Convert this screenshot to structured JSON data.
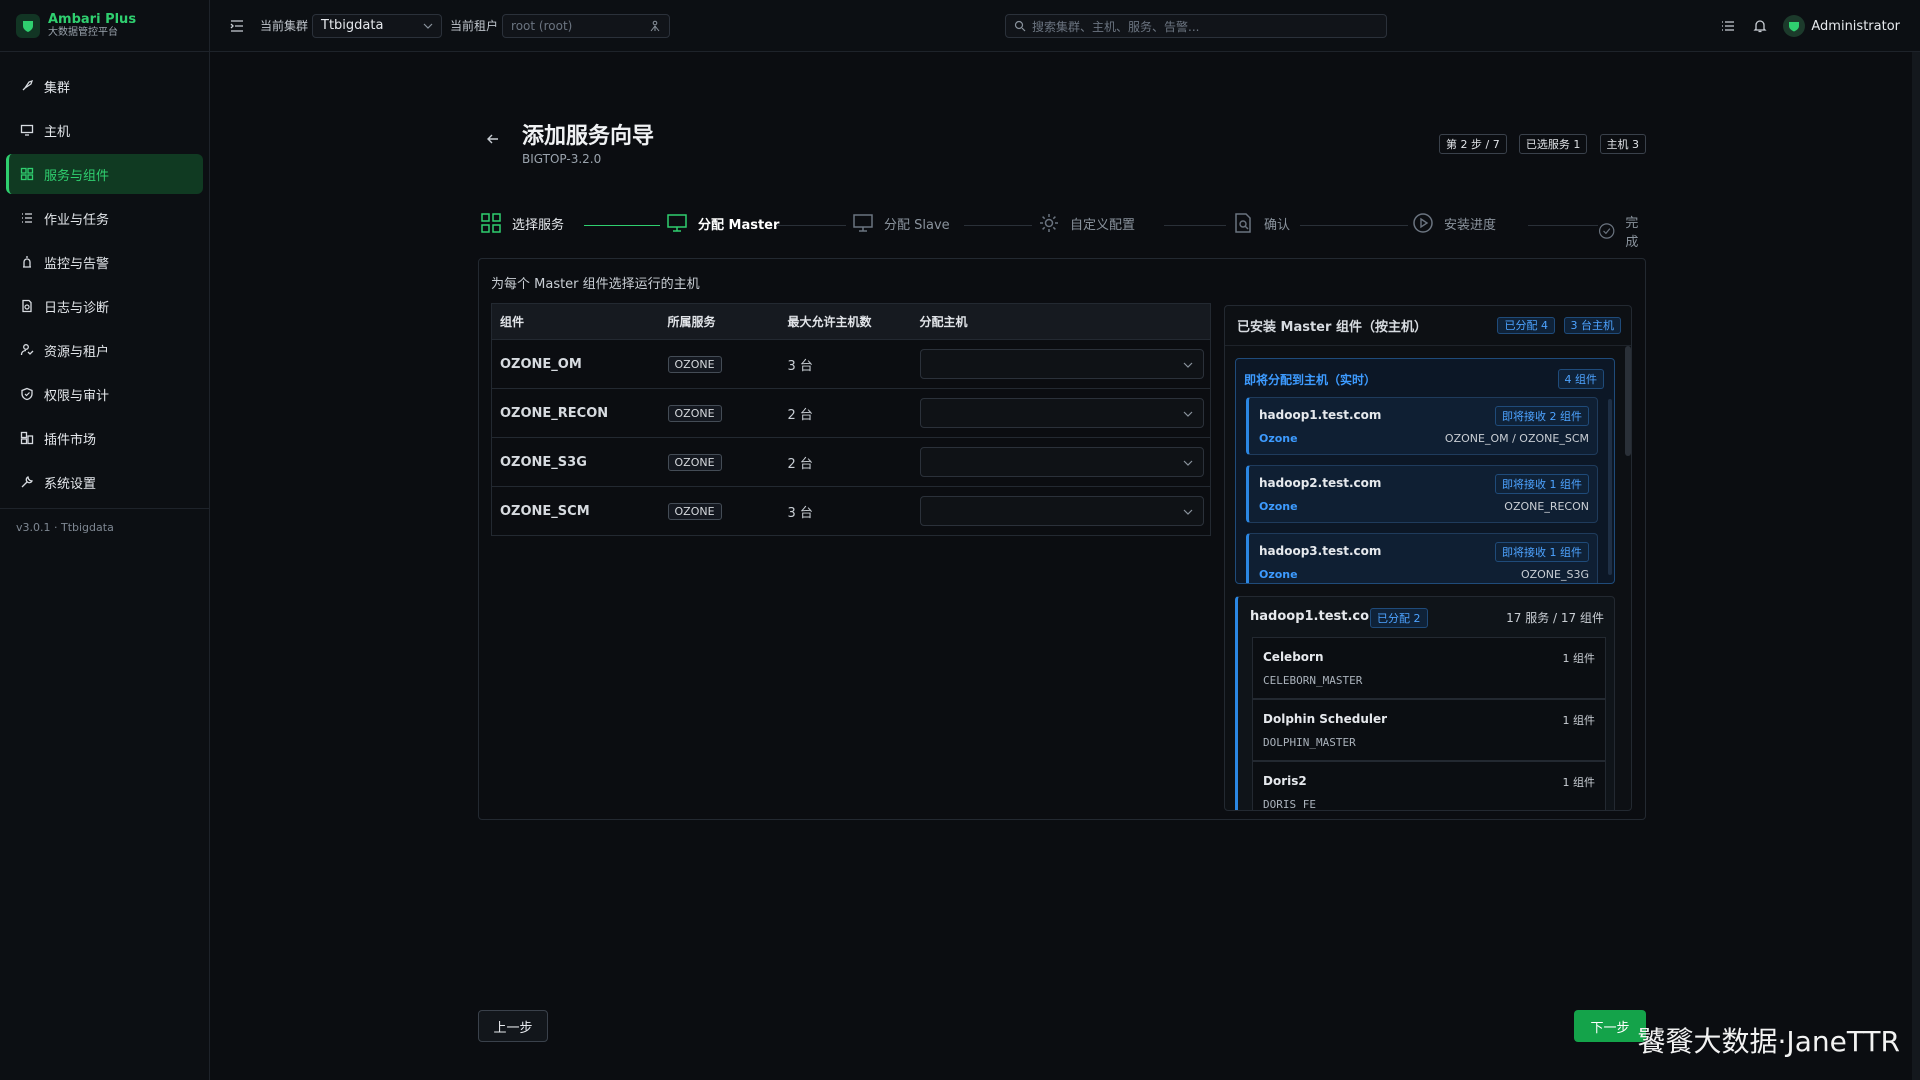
{
  "brand": {
    "title": "Ambari Plus",
    "subtitle": "大数据管控平台"
  },
  "sidebar": {
    "items": [
      {
        "label": "集群",
        "icon": "rocket-icon",
        "active": false
      },
      {
        "label": "主机",
        "icon": "monitor-icon",
        "active": false
      },
      {
        "label": "服务与组件",
        "icon": "grid-icon",
        "active": true
      },
      {
        "label": "作业与任务",
        "icon": "list-icon",
        "active": false
      },
      {
        "label": "监控与告警",
        "icon": "alarm-icon",
        "active": false
      },
      {
        "label": "日志与诊断",
        "icon": "log-icon",
        "active": false
      },
      {
        "label": "资源与租户",
        "icon": "users-icon",
        "active": false
      },
      {
        "label": "权限与审计",
        "icon": "shield-icon",
        "active": false
      },
      {
        "label": "插件市场",
        "icon": "plugin-icon",
        "active": false
      },
      {
        "label": "系统设置",
        "icon": "wrench-icon",
        "active": false
      }
    ],
    "version": "v3.0.1 · Ttbigdata"
  },
  "topbar": {
    "cluster_label": "当前集群",
    "cluster_value": "Ttbigdata",
    "tenant_label": "当前租户",
    "tenant_placeholder": "root (root)",
    "search_placeholder": "搜索集群、主机、服务、告警...",
    "user": "Administrator"
  },
  "wizard": {
    "title": "添加服务向导",
    "version": "BIGTOP-3.2.0",
    "badges": [
      "第 2 步 / 7",
      "已选服务 1",
      "主机 3"
    ],
    "steps": [
      {
        "label": "选择服务",
        "state": "done"
      },
      {
        "label": "分配 Master",
        "state": "active"
      },
      {
        "label": "分配 Slave",
        "state": "pending"
      },
      {
        "label": "自定义配置",
        "state": "pending"
      },
      {
        "label": "确认",
        "state": "pending"
      },
      {
        "label": "安装进度",
        "state": "pending"
      },
      {
        "label": "完成",
        "state": "pending"
      }
    ],
    "instruction": "为每个 Master 组件选择运行的主机",
    "table": {
      "headers": [
        "组件",
        "所属服务",
        "最大允许主机数",
        "分配主机"
      ],
      "rows": [
        {
          "component": "OZONE_OM",
          "service": "OZONE",
          "max": "3 台"
        },
        {
          "component": "OZONE_RECON",
          "service": "OZONE",
          "max": "2 台"
        },
        {
          "component": "OZONE_S3G",
          "service": "OZONE",
          "max": "2 台"
        },
        {
          "component": "OZONE_SCM",
          "service": "OZONE",
          "max": "3 台"
        }
      ]
    },
    "panel": {
      "title": "已安装 Master 组件（按主机）",
      "badge_assigned": "已分配 4",
      "badge_hosts": "3 台主机",
      "assign_title": "即将分配到主机（实时）",
      "assign_badge": "4 组件",
      "assign_hosts": [
        {
          "host": "hadoop1.test.com",
          "receive": "即将接收 2 组件",
          "service": "Ozone",
          "components": "OZONE_OM / OZONE_SCM"
        },
        {
          "host": "hadoop2.test.com",
          "receive": "即将接收 1 组件",
          "service": "Ozone",
          "components": "OZONE_RECON"
        },
        {
          "host": "hadoop3.test.com",
          "receive": "即将接收 1 组件",
          "service": "Ozone",
          "components": "OZONE_S3G"
        }
      ],
      "installed_host": "hadoop1.test.com",
      "installed_badge": "已分配 2",
      "installed_summary": "17 服务 / 17 组件",
      "installed_items": [
        {
          "name": "Celeborn",
          "component": "CELEBORN_MASTER",
          "count": "1 组件"
        },
        {
          "name": "Dolphin Scheduler",
          "component": "DOLPHIN_MASTER",
          "count": "1 组件"
        },
        {
          "name": "Doris2",
          "component": "DORIS_FE",
          "count": "1 组件"
        }
      ]
    },
    "prev_label": "上一步",
    "next_label": "下一步"
  },
  "watermark": "饕餮大数据·JaneTTR",
  "colors": {
    "accent": "#2fcf6f",
    "blue": "#3d9bff",
    "bg": "#0b0d11"
  }
}
